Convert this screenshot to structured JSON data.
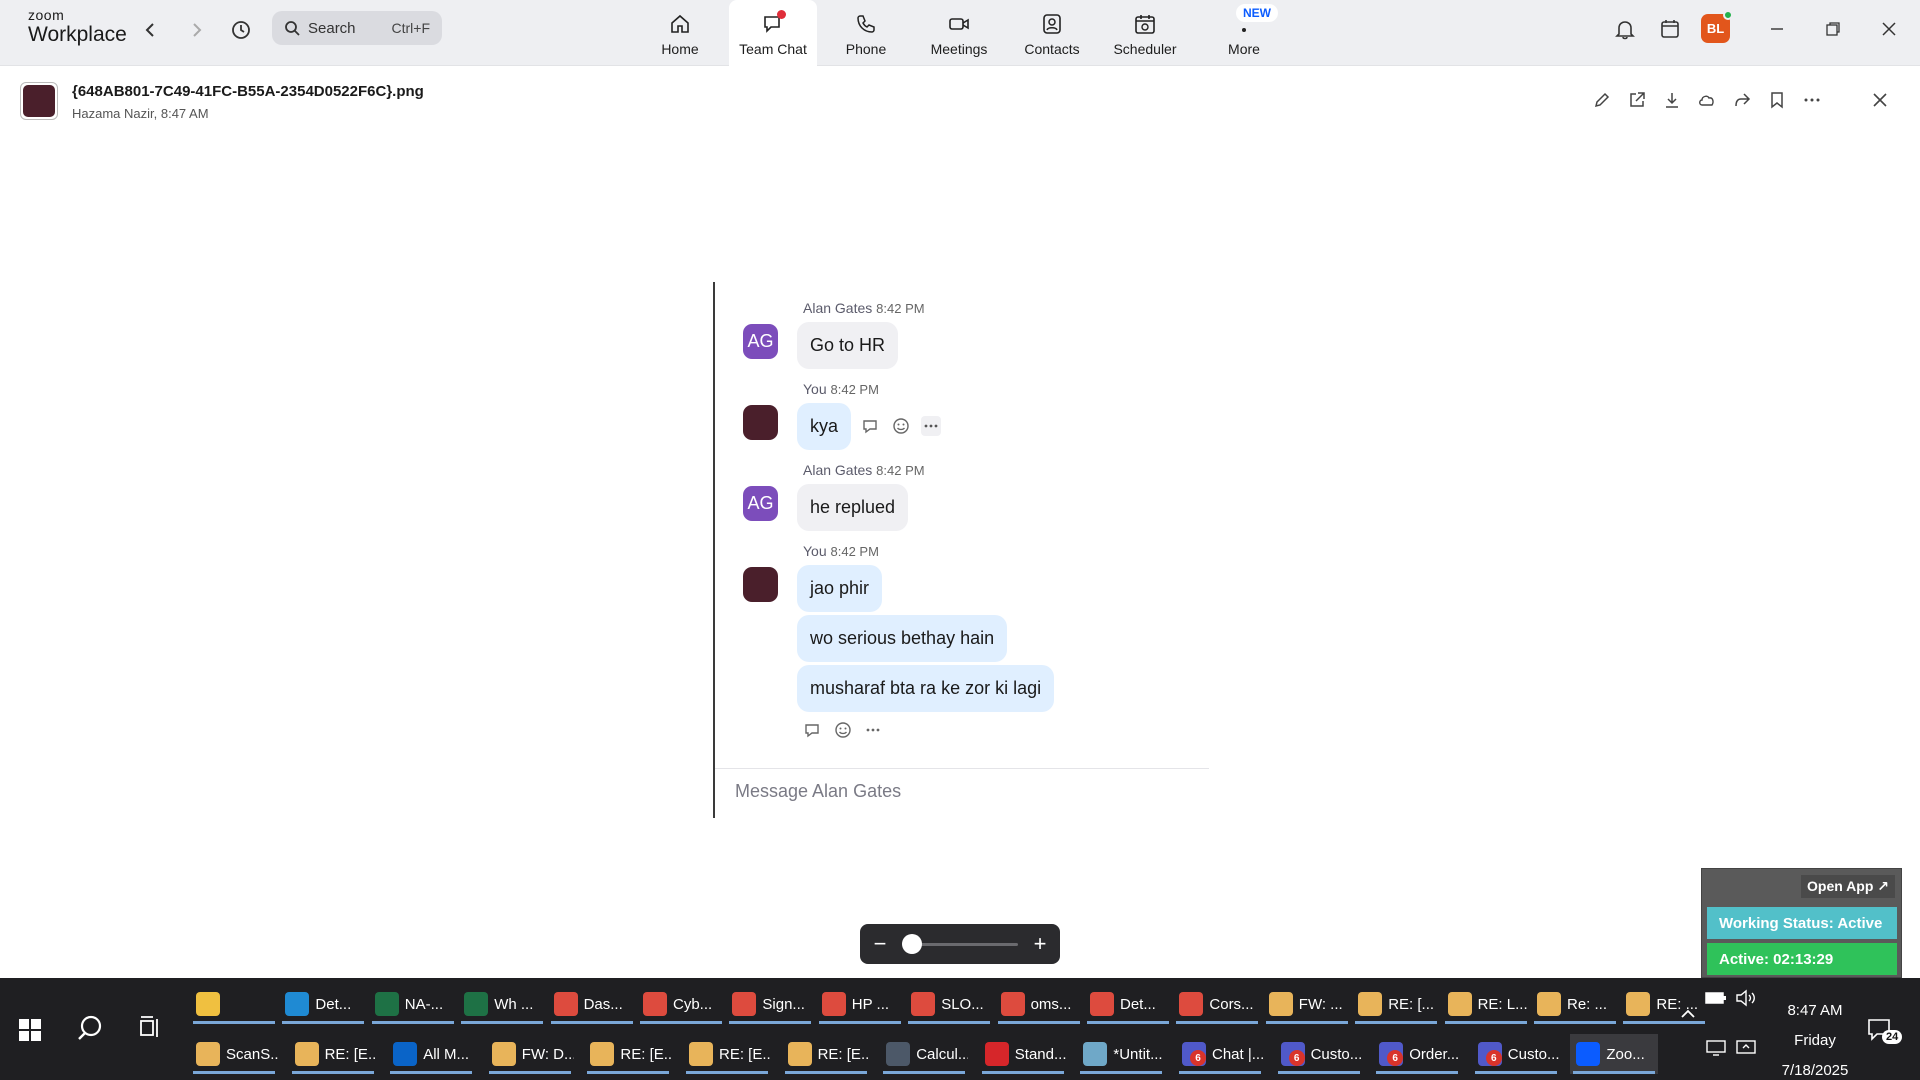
{
  "app": {
    "brand_top": "zoom",
    "brand_bottom": "Workplace"
  },
  "search": {
    "label": "Search",
    "shortcut": "Ctrl+F"
  },
  "tabs": [
    {
      "label": "Home"
    },
    {
      "label": "Team Chat"
    },
    {
      "label": "Phone"
    },
    {
      "label": "Meetings"
    },
    {
      "label": "Contacts"
    },
    {
      "label": "Scheduler"
    },
    {
      "label": "More",
      "badge": "NEW"
    }
  ],
  "user": {
    "initials": "BL"
  },
  "file": {
    "name": "{648AB801-7C49-41FC-B55A-2354D0522F6C}.png",
    "meta": "Hazama Nazir, 8:47 AM"
  },
  "chat": {
    "messages": [
      {
        "sender": "Alan Gates",
        "time": "8:42 PM",
        "avatar": "AG",
        "texts": [
          "Go to HR"
        ]
      },
      {
        "sender": "You",
        "time": "8:42 PM",
        "avatar": "",
        "texts": [
          "kya"
        ]
      },
      {
        "sender": "Alan Gates",
        "time": "8:42 PM",
        "avatar": "AG",
        "texts": [
          "he replued"
        ]
      },
      {
        "sender": "You",
        "time": "8:42 PM",
        "avatar": "",
        "texts": [
          "jao phir",
          "wo serious bethay hain",
          "musharaf bta ra ke zor ki lagi"
        ]
      }
    ],
    "compose_placeholder": "Message Alan Gates"
  },
  "zoom": {
    "minus": "−",
    "plus": "+",
    "level": 0
  },
  "working_status": {
    "open_app": "Open App ↗",
    "status": "Working Status: Active",
    "active": "Active: 02:13:29"
  },
  "taskbar": {
    "row1": [
      {
        "label": "",
        "icon": "file-explorer-icon",
        "color": "#f0c040"
      },
      {
        "label": "Det...",
        "icon": "edge-icon",
        "color": "#1f8ad3"
      },
      {
        "label": "NA-...",
        "icon": "excel-icon",
        "color": "#1e7145"
      },
      {
        "label": "Wh ...",
        "icon": "excel-icon",
        "color": "#1e7145"
      },
      {
        "label": "Das...",
        "icon": "chrome-icon",
        "color": "#dd4b3e"
      },
      {
        "label": "Cyb...",
        "icon": "chrome-icon",
        "color": "#dd4b3e"
      },
      {
        "label": "Sign...",
        "icon": "chrome-icon",
        "color": "#dd4b3e"
      },
      {
        "label": "HP ...",
        "icon": "chrome-icon",
        "color": "#dd4b3e"
      },
      {
        "label": "SLO...",
        "icon": "chrome-icon",
        "color": "#dd4b3e"
      },
      {
        "label": "oms...",
        "icon": "chrome-icon",
        "color": "#dd4b3e"
      },
      {
        "label": "Det...",
        "icon": "chrome-icon",
        "color": "#dd4b3e"
      },
      {
        "label": "Cors...",
        "icon": "chrome-icon",
        "color": "#dd4b3e"
      },
      {
        "label": "FW: ...",
        "icon": "mail-icon",
        "color": "#e8b45a"
      },
      {
        "label": "RE: [...",
        "icon": "mail-icon",
        "color": "#e8b45a"
      },
      {
        "label": "RE: L...",
        "icon": "mail-icon",
        "color": "#e8b45a"
      },
      {
        "label": "Re: ...",
        "icon": "mail-icon",
        "color": "#e8b45a"
      },
      {
        "label": "RE: ...",
        "icon": "mail-icon",
        "color": "#e8b45a"
      }
    ],
    "row2": [
      {
        "label": "ScanS...",
        "icon": "mail-icon",
        "color": "#e8b45a"
      },
      {
        "label": "RE: [E...",
        "icon": "mail-icon",
        "color": "#e8b45a"
      },
      {
        "label": "All M...",
        "icon": "outlook-icon",
        "color": "#0a64c8"
      },
      {
        "label": "FW: D...",
        "icon": "mail-icon",
        "color": "#e8b45a"
      },
      {
        "label": "RE: [E...",
        "icon": "mail-icon",
        "color": "#e8b45a"
      },
      {
        "label": "RE: [E...",
        "icon": "mail-icon",
        "color": "#e8b45a"
      },
      {
        "label": "RE: [E...",
        "icon": "mail-icon",
        "color": "#e8b45a"
      },
      {
        "label": "Calcul...",
        "icon": "calculator-icon",
        "color": "#4c5868"
      },
      {
        "label": "Stand...",
        "icon": "pdf-icon",
        "color": "#d6262a"
      },
      {
        "label": "*Untit...",
        "icon": "notepad-icon",
        "color": "#6fa8c8"
      },
      {
        "label": "Chat |...",
        "icon": "teams-icon",
        "color": "#5059c9",
        "count": "6"
      },
      {
        "label": "Custo...",
        "icon": "teams-icon",
        "color": "#5059c9",
        "count": "6"
      },
      {
        "label": "Order...",
        "icon": "teams-icon",
        "color": "#5059c9",
        "count": "6"
      },
      {
        "label": "Custo...",
        "icon": "teams-icon",
        "color": "#5059c9",
        "count": "6"
      },
      {
        "label": "Zoo...",
        "icon": "zoom-icon",
        "color": "#0b5cff",
        "active": true
      }
    ],
    "clock": {
      "time": "8:47 AM",
      "day": "Friday",
      "date": "7/18/2025"
    },
    "notifications": "24"
  },
  "colors": {
    "accent": "#0b5cff",
    "topbar": "#eeeff2",
    "avatar_ag": "#7c4dbb"
  }
}
